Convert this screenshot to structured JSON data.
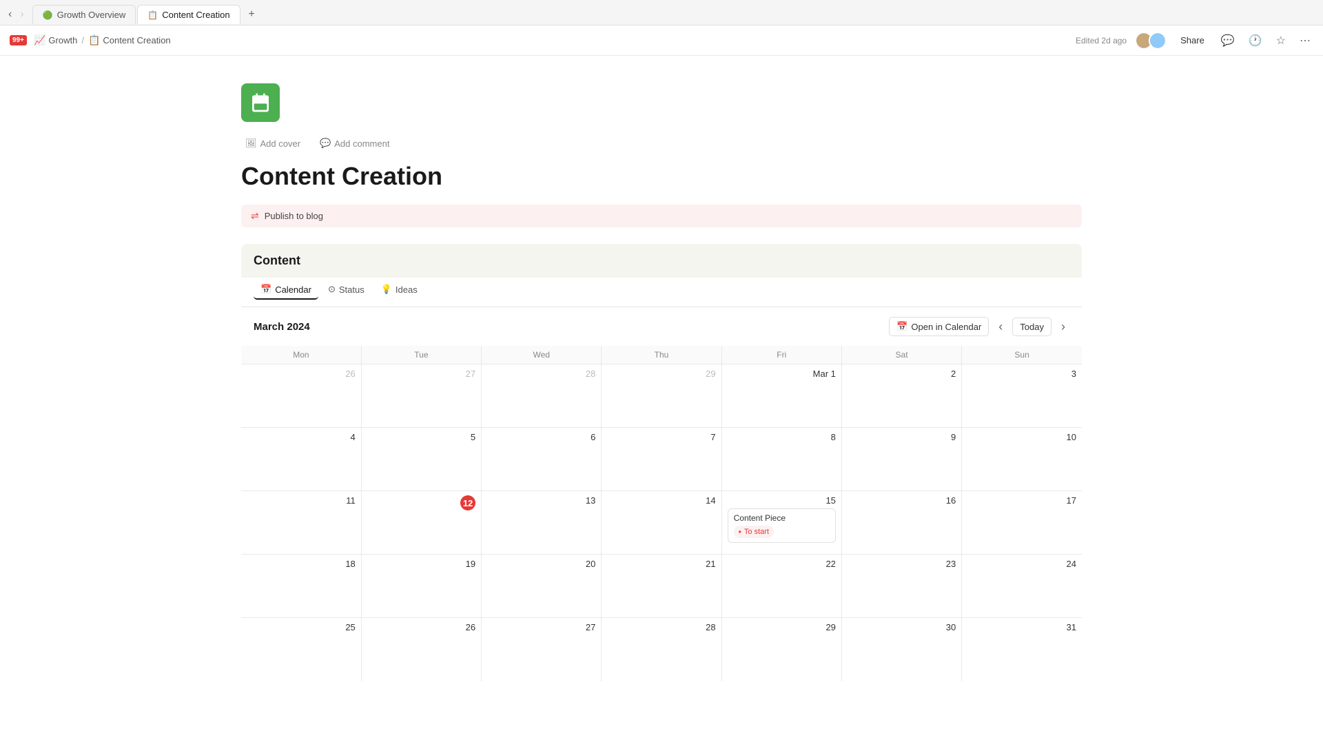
{
  "browser": {
    "tabs": [
      {
        "id": "growth-overview",
        "label": "Growth Overview",
        "icon": "🟢",
        "active": false
      },
      {
        "id": "content-creation",
        "label": "Content Creation",
        "icon": "📋",
        "active": true
      }
    ],
    "new_tab_label": "+",
    "nav_back": "‹",
    "nav_forward": "›"
  },
  "app": {
    "logo": "99+",
    "breadcrumb": [
      {
        "label": "Growth",
        "icon": "growth"
      },
      {
        "label": "Content Creation",
        "icon": "database"
      }
    ],
    "header": {
      "edited_label": "Edited 2d ago",
      "share_label": "Share"
    }
  },
  "page": {
    "add_cover_label": "Add cover",
    "add_comment_label": "Add comment",
    "title": "Content Creation",
    "linked_mention": "Publish to blog",
    "section_title": "Content",
    "tabs": [
      {
        "id": "calendar",
        "label": "Calendar",
        "icon": "📅",
        "active": true
      },
      {
        "id": "status",
        "label": "Status",
        "icon": "⊙",
        "active": false
      },
      {
        "id": "ideas",
        "label": "Ideas",
        "icon": "💡",
        "active": false
      }
    ],
    "calendar": {
      "month_label": "March 2024",
      "open_calendar_btn": "Open in Calendar",
      "today_btn": "Today",
      "day_headers": [
        "Mon",
        "Tue",
        "Wed",
        "Thu",
        "Fri",
        "Sat",
        "Sun"
      ],
      "weeks": [
        [
          {
            "num": "26",
            "other": true
          },
          {
            "num": "27",
            "other": true
          },
          {
            "num": "28",
            "other": true
          },
          {
            "num": "29",
            "other": true
          },
          {
            "num": "Mar 1",
            "highlight": false
          },
          {
            "num": "2",
            "highlight": false
          },
          {
            "num": "3",
            "highlight": false
          }
        ],
        [
          {
            "num": "4"
          },
          {
            "num": "5"
          },
          {
            "num": "6"
          },
          {
            "num": "7"
          },
          {
            "num": "8"
          },
          {
            "num": "9"
          },
          {
            "num": "10"
          }
        ],
        [
          {
            "num": "11"
          },
          {
            "num": "12",
            "today": true
          },
          {
            "num": "13"
          },
          {
            "num": "14"
          },
          {
            "num": "15",
            "event": {
              "title": "Content Piece",
              "status": "To start"
            }
          },
          {
            "num": "16"
          },
          {
            "num": "17"
          }
        ],
        [
          {
            "num": "18"
          },
          {
            "num": "19"
          },
          {
            "num": "20"
          },
          {
            "num": "21"
          },
          {
            "num": "22"
          },
          {
            "num": "23"
          },
          {
            "num": "24"
          }
        ],
        [
          {
            "num": "25"
          },
          {
            "num": "26"
          },
          {
            "num": "27"
          },
          {
            "num": "28"
          },
          {
            "num": "29"
          },
          {
            "num": "30"
          },
          {
            "num": "31"
          }
        ]
      ]
    }
  },
  "colors": {
    "green": "#4caf50",
    "red": "#e53935",
    "accent": "#5b78f5"
  }
}
